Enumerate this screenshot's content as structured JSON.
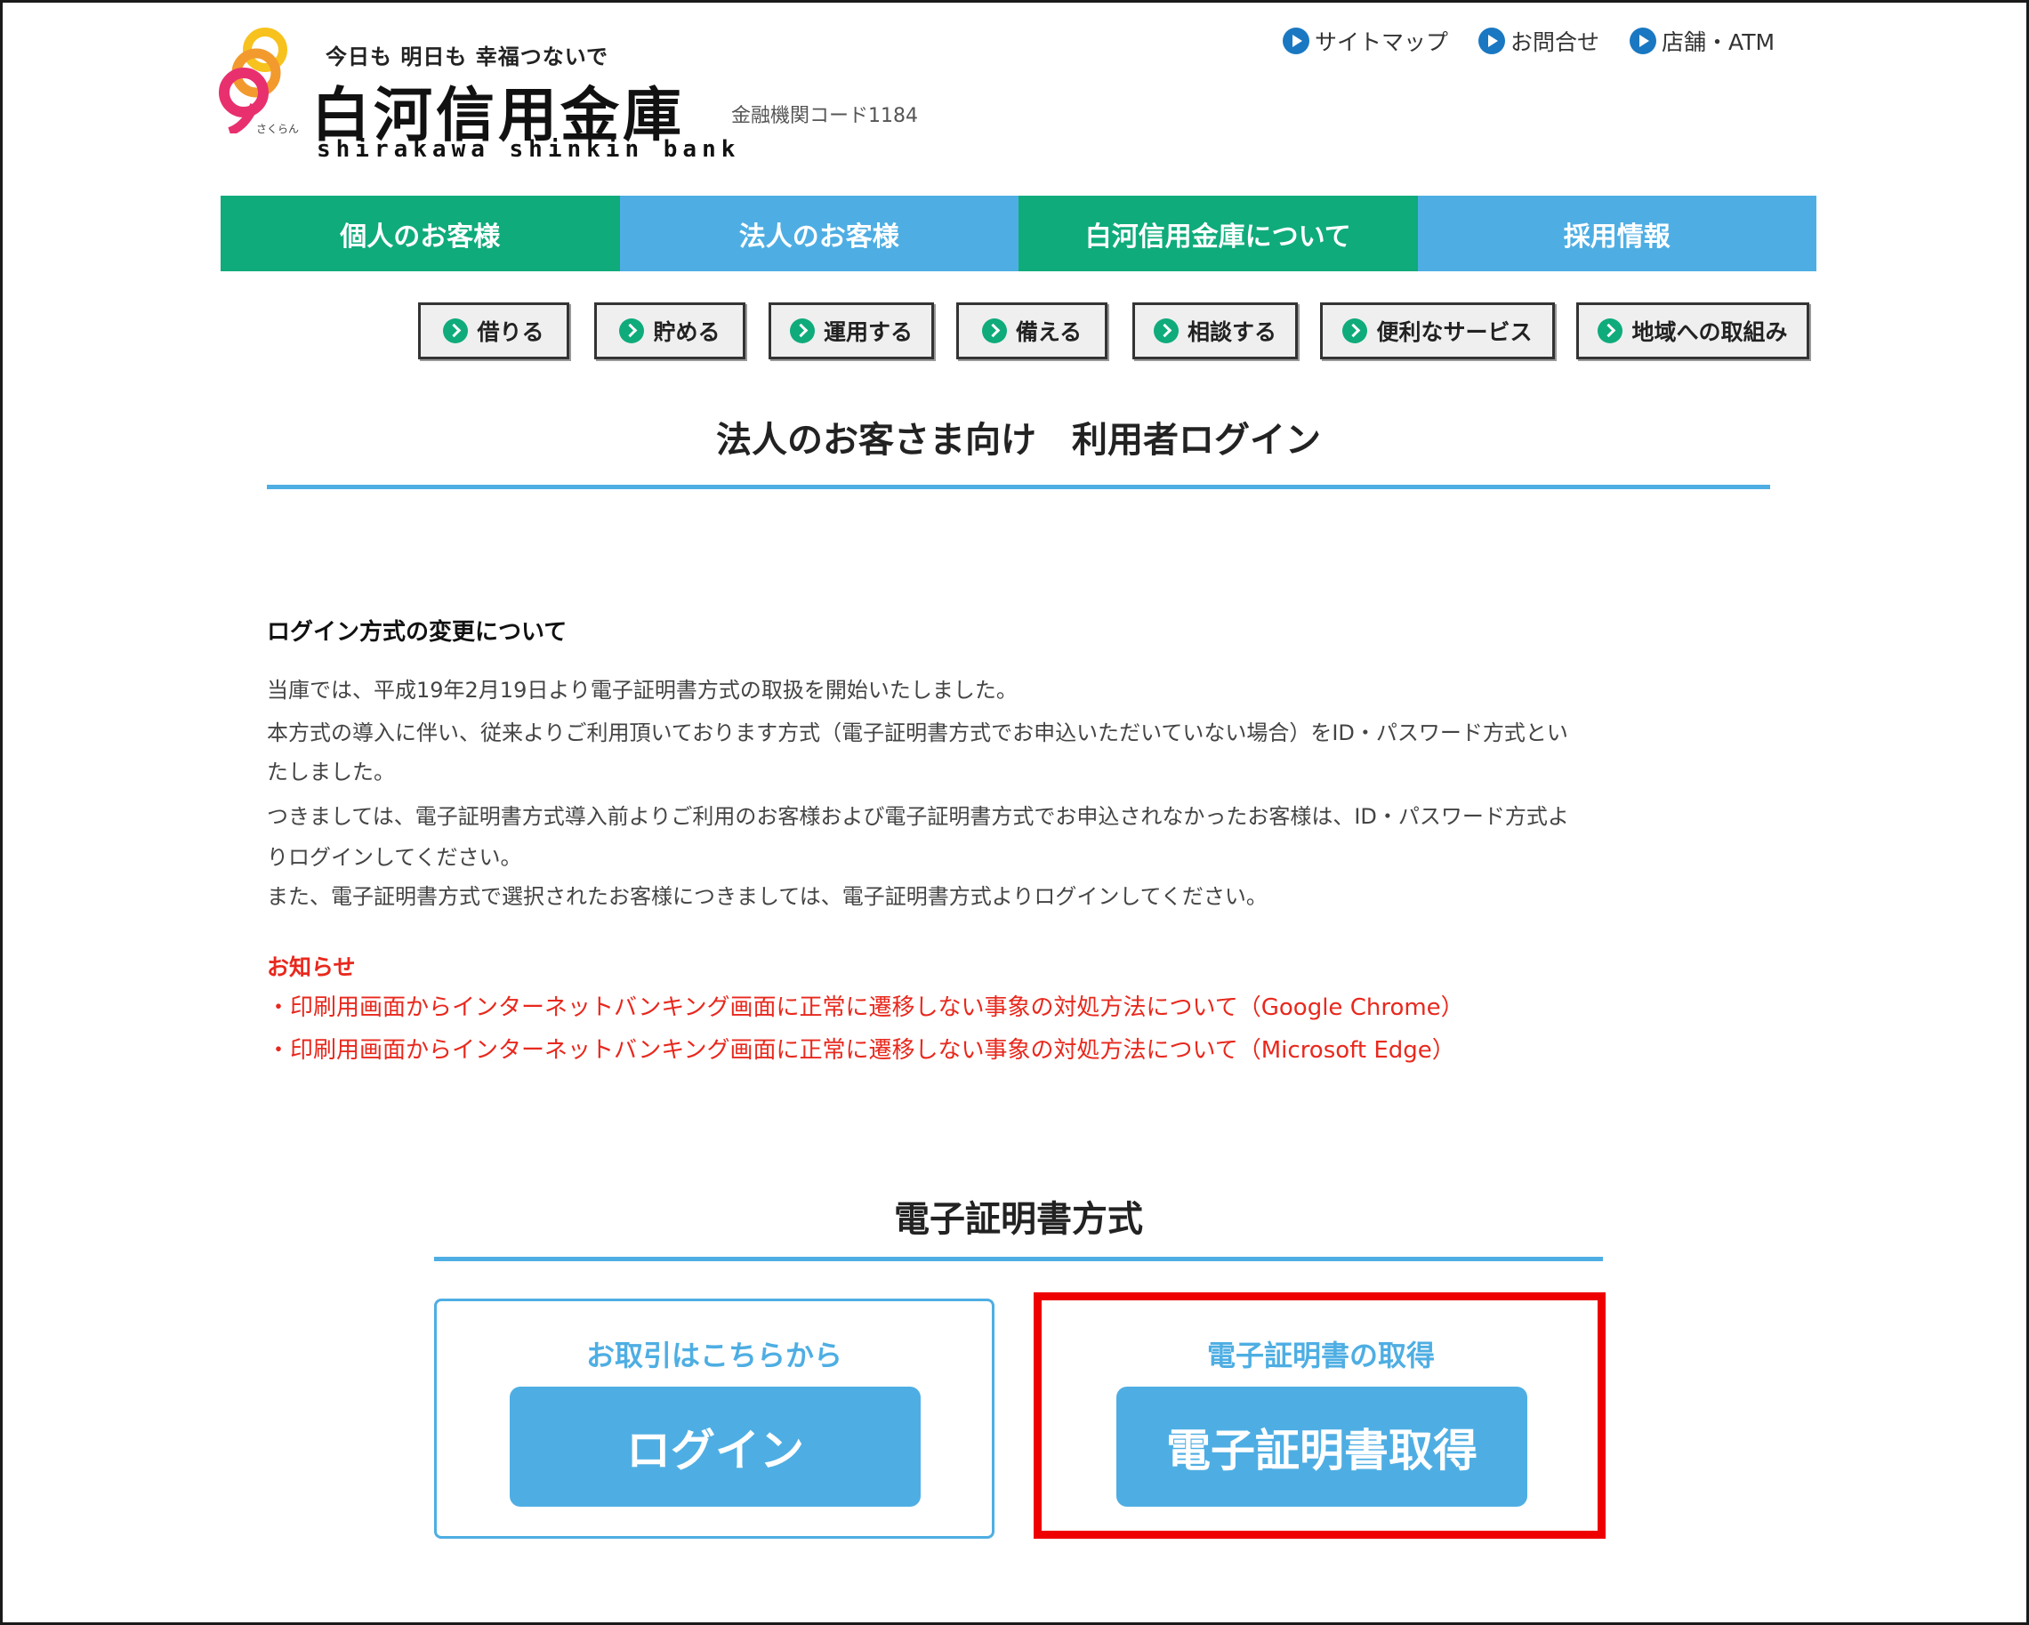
{
  "header": {
    "tagline": "今日も 明日も 幸福つないで",
    "bank_name": "白河信用金庫",
    "bank_name_roman": "shirakawa shinkin bank",
    "bank_code": "金融機関コード1184",
    "logo_caption": "さくらん",
    "logo_colors": [
      "#e8306f",
      "#f29a2e",
      "#f7c21e"
    ]
  },
  "utility_nav": [
    {
      "label": "サイトマップ",
      "icon": "arrow-circle-icon"
    },
    {
      "label": "お問合せ",
      "icon": "arrow-circle-icon"
    },
    {
      "label": "店舗・ATM",
      "icon": "arrow-circle-icon"
    }
  ],
  "main_nav": [
    {
      "label": "個人のお客様",
      "color": "#0fab7b"
    },
    {
      "label": "法人のお客様",
      "color": "#4eaee3"
    },
    {
      "label": "白河信用金庫について",
      "color": "#0fab7b"
    },
    {
      "label": "採用情報",
      "color": "#4eaee3"
    }
  ],
  "sub_nav": [
    {
      "label": "借りる"
    },
    {
      "label": "貯める"
    },
    {
      "label": "運用する"
    },
    {
      "label": "備える"
    },
    {
      "label": "相談する"
    },
    {
      "label": "便利なサービス"
    },
    {
      "label": "地域への取組み"
    }
  ],
  "page_title": "法人のお客さま向け　利用者ログイン",
  "notice": {
    "heading": "ログイン方式の変更について",
    "paragraphs": [
      "当庫では、平成19年2月19日より電子証明書方式の取扱を開始いたしました。",
      "本方式の導入に伴い、従来よりご利用頂いております方式（電子証明書方式でお申込いただいていない場合）をID・パスワード方式とい",
      "たしました。",
      "つきましては、電子証明書方式導入前よりご利用のお客様および電子証明書方式でお申込されなかったお客様は、ID・パスワード方式よ",
      "りログインしてください。",
      "また、電子証明書方式で選択されたお客様につきましては、電子証明書方式よりログインしてください。"
    ]
  },
  "info": {
    "heading": "お知らせ",
    "links": [
      "・印刷用画面からインターネットバンキング画面に正常に遷移しない事象の対処方法について（Google Chrome）",
      "・印刷用画面からインターネットバンキング画面に正常に遷移しない事象の対処方法について（Microsoft Edge）"
    ]
  },
  "certificate_section": {
    "title": "電子証明書方式",
    "cards": [
      {
        "label": "お取引はこちらから",
        "button": "ログイン"
      },
      {
        "label": "電子証明書の取得",
        "button": "電子証明書取得",
        "highlighted": true
      }
    ]
  },
  "colors": {
    "green": "#0fab7b",
    "blue": "#4eaee3",
    "alert_red": "#e8281d",
    "highlight_red": "#ee0000"
  }
}
